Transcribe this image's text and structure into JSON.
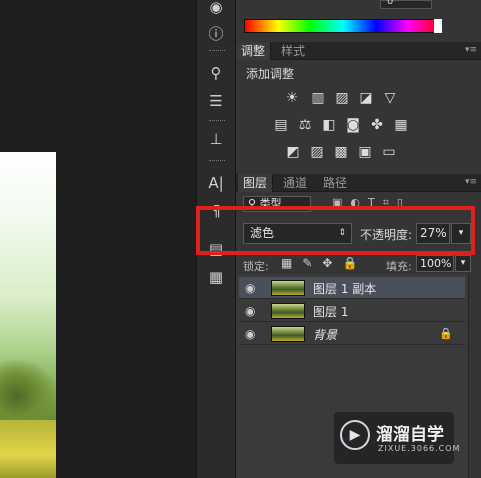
{
  "adjustments": {
    "tab_adjust": "调整",
    "tab_styles": "样式",
    "add_adjustment": "添加调整",
    "panel_value_partial": "0"
  },
  "layers_panel": {
    "tabs": [
      "图层",
      "通道",
      "路径"
    ],
    "filter_kind": "类型",
    "blend_mode": "滤色",
    "opacity_label": "不透明度:",
    "opacity_value": "27%",
    "lock_label": "锁定:",
    "fill_label": "填充:",
    "fill_value": "100%",
    "layers": [
      {
        "name": "图层 1 副本",
        "selected": true
      },
      {
        "name": "图层 1",
        "selected": false
      },
      {
        "name": "背景",
        "selected": false,
        "locked": true
      }
    ]
  },
  "watermark": {
    "title": "溜溜自学",
    "url": "ZIXUE.3066.COM"
  },
  "colors": {
    "highlight": "#e0201b",
    "panel": "#353535",
    "selected_layer": "#4a4f59"
  }
}
